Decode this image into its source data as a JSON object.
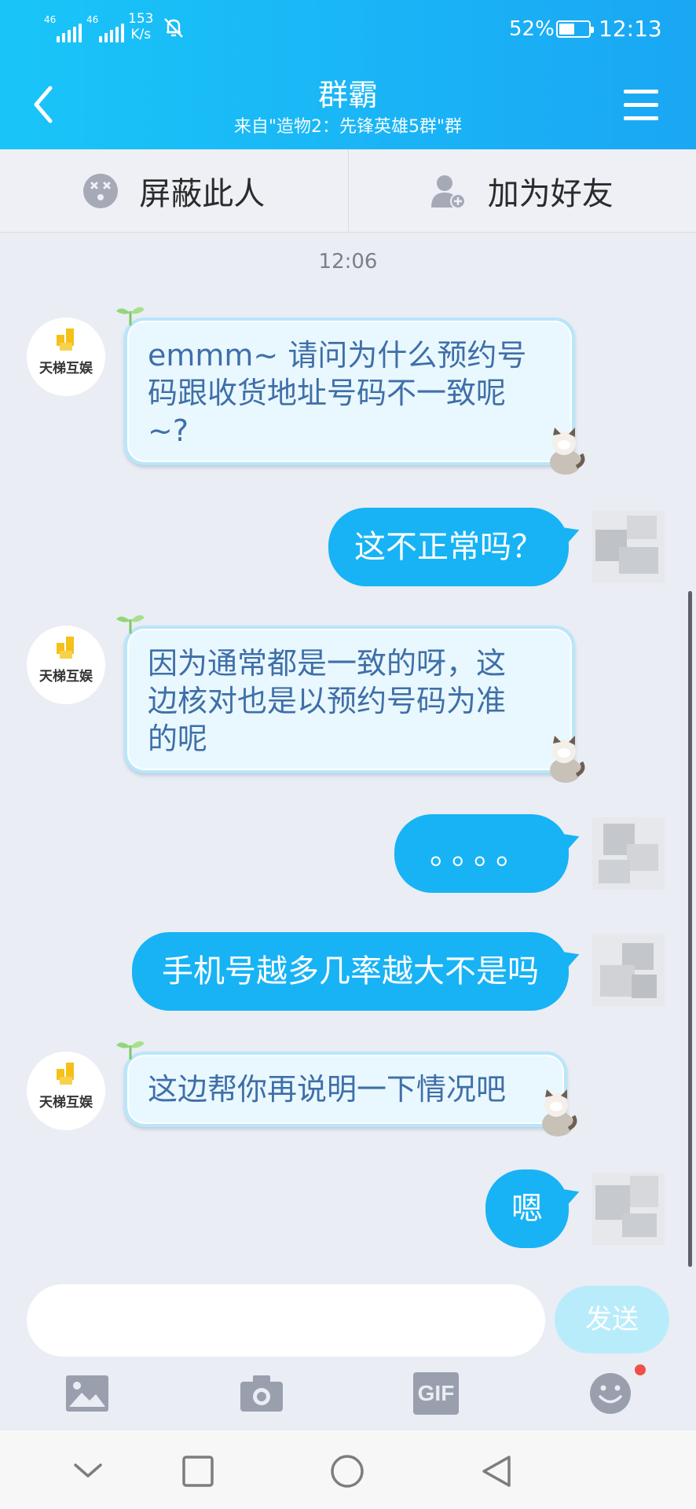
{
  "status_bar": {
    "signal1_label": "46",
    "signal2_label": "46",
    "net_speed_value": "153",
    "net_speed_unit": "K/s",
    "battery_percent": "52%",
    "battery_level": 0.52,
    "time": "12:13"
  },
  "header": {
    "title": "群霸",
    "subtitle": "来自\"造物2：先锋英雄5群\"群"
  },
  "actions": {
    "block_label": "屏蔽此人",
    "add_friend_label": "加为好友"
  },
  "chat": {
    "timestamp": "12:06",
    "avatar_brand": "天梯互娱",
    "messages": [
      {
        "side": "received",
        "lines": [
          "emmm~ 请问为什么预约号",
          "码跟收货地址号码不一致呢",
          "~?"
        ]
      },
      {
        "side": "sent",
        "text": "这不正常吗？"
      },
      {
        "side": "received",
        "lines": [
          "因为通常都是一致的呀，这",
          "边核对也是以预约号码为准",
          "的呢"
        ]
      },
      {
        "side": "sent",
        "text": "。。。。"
      },
      {
        "side": "sent",
        "text": "手机号越多几率越大不是吗"
      },
      {
        "side": "received",
        "lines": [
          "这边帮你再说明一下情况吧"
        ]
      },
      {
        "side": "sent",
        "text": "嗯"
      }
    ]
  },
  "input": {
    "value": "",
    "send_label": "发送"
  },
  "toolbar": {
    "icons": [
      "image-icon",
      "camera-icon",
      "gif-icon",
      "emoji-icon"
    ],
    "gif_label": "GIF"
  },
  "colors": {
    "header_start": "#19c5f8",
    "header_end": "#1aa7f4",
    "sent_bubble": "#17b3f5",
    "received_text": "#3f6fa8",
    "notification_dot": "#f0504a"
  }
}
